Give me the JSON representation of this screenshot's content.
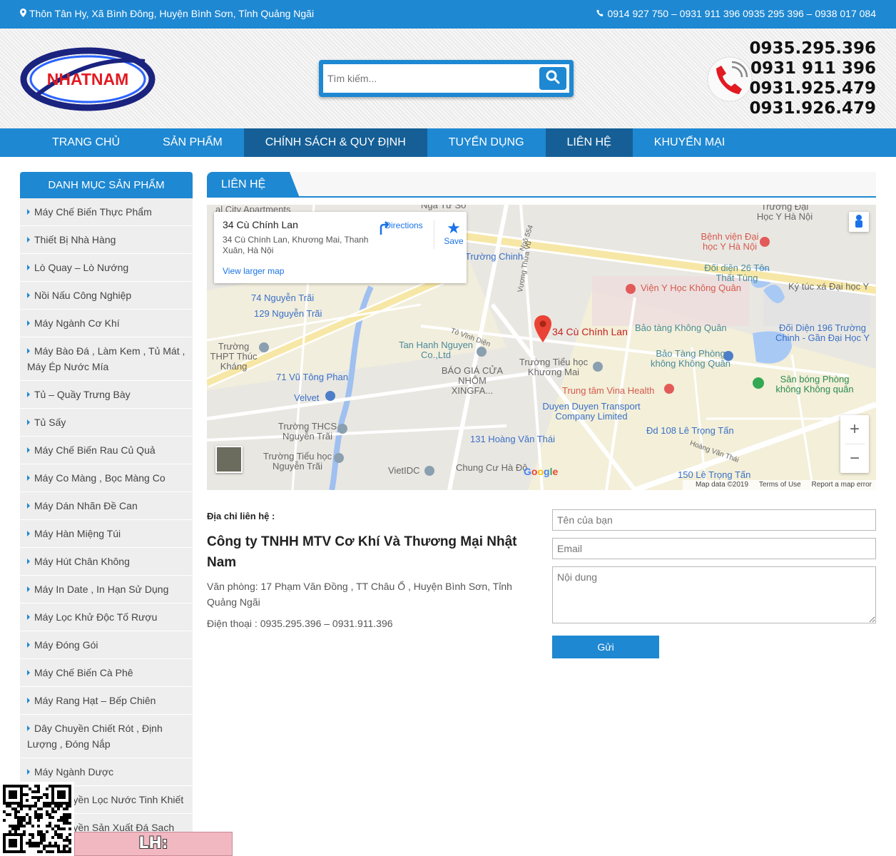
{
  "topbar": {
    "address": "Thôn Tân Hy, Xã Bình Đông, Huyện Bình Sơn, Tỉnh Quảng Ngãi",
    "phones": "0914 927 750 – 0931 911 396 0935 295 396 – 0938 017 084"
  },
  "header": {
    "logo_text": "NHATNAM",
    "search_placeholder": "Tìm kiếm...",
    "hotlines": [
      "0935.295.396",
      "0931 911 396",
      "0931.925.479",
      "0931.926.479"
    ]
  },
  "nav": {
    "items": [
      {
        "label": "TRANG CHỦ"
      },
      {
        "label": "SẢN PHẨM"
      },
      {
        "label": "CHÍNH SÁCH & QUY ĐỊNH"
      },
      {
        "label": "TUYỂN DỤNG"
      },
      {
        "label": "LIÊN HỆ"
      },
      {
        "label": "KHUYẾN MẠI"
      }
    ]
  },
  "sidebar": {
    "title": "DANH MỤC SẢN PHẨM",
    "items": [
      "Máy Chế Biến Thực Phẩm",
      "Thiết Bị Nhà Hàng",
      "Lò Quay – Lò Nướng",
      "Nồi Nấu Công Nghiệp",
      "Máy Ngành Cơ Khí",
      "Máy Bào Đá , Làm Kem , Tủ Mát , Máy Ép Nước Mía",
      "Tủ – Quầy Trưng Bày",
      "Tủ Sấy",
      "Máy Chế Biến Rau Củ Quả",
      "Máy Co Màng , Bọc Màng Co",
      "Máy Dán Nhãn Đề Can",
      "Máy Hàn Miệng Túi",
      "Máy Hút Chân Không",
      "Máy In Date , In Hạn Sử Dụng",
      "Máy Lọc Khử Độc Tố Rượu",
      "Máy Đóng Gói",
      "Máy Chế Biến Cà Phê",
      "Máy Rang Hạt – Bếp Chiên",
      "Dây Chuyền Chiết Rót , Định Lượng , Đóng Nắp",
      "Máy Ngành Dược",
      "Dây Chuyền Lọc Nước Tinh Khiết",
      "Dây Chuyền Sản Xuất Đá Sạch"
    ]
  },
  "content": {
    "tab_title": "LIÊN HỆ",
    "map": {
      "place_title": "34 Cù Chính Lan",
      "place_address": "34 Cù Chính Lan, Khương Mai, Thanh Xuân, Hà Nội",
      "directions": "Directions",
      "save": "Save",
      "larger_map": "View larger map",
      "pin_label": "34 Cù Chính Lan",
      "zoom_in": "+",
      "zoom_out": "−",
      "attribution": [
        "Map data ©2019",
        "Terms of Use",
        "Report a map error"
      ],
      "places": [
        {
          "name": "Nga Tư So",
          "kind": "gray"
        },
        {
          "name": "al City Apartments",
          "kind": "gray"
        },
        {
          "name": "Ngõ 554",
          "kind": "gray"
        },
        {
          "name": "Trường Đại Học Y Hà Nội",
          "kind": "gray"
        },
        {
          "name": "Bệnh viện Đại học Y Hà Nội",
          "kind": "red"
        },
        {
          "name": "Đối diện 26 Tôn Thất Tùng",
          "kind": "teal"
        },
        {
          "name": "Viện Y Học Không Quân",
          "kind": "red"
        },
        {
          "name": "Ký túc xá Đại học Y",
          "kind": "gray"
        },
        {
          "name": "Trường Chinh",
          "kind": "blue"
        },
        {
          "name": "74 Nguyễn Trãi",
          "kind": "blue"
        },
        {
          "name": "129 Nguyễn Trãi",
          "kind": "blue"
        },
        {
          "name": "Bảo tàng Không Quân",
          "kind": "teal"
        },
        {
          "name": "Đối Diện 196 Trường Chinh - Gần Đại Học Y",
          "kind": "blue"
        },
        {
          "name": "Tan Hanh Nguyen Co.,Ltd",
          "kind": "teal"
        },
        {
          "name": "Trường THPT Thúc Kháng",
          "kind": "gray"
        },
        {
          "name": "BÁO GIÁ CỬA NHÔM XINGFA...",
          "kind": "gray"
        },
        {
          "name": "Trường Tiểu học Khương Mai",
          "kind": "gray"
        },
        {
          "name": "Bảo Tàng Phòng không Không Quân",
          "kind": "teal"
        },
        {
          "name": "71 Vũ Tông Phan",
          "kind": "blue"
        },
        {
          "name": "Sân bóng Phòng không Không quân",
          "kind": "green"
        },
        {
          "name": "Trung tâm Vina Health",
          "kind": "red"
        },
        {
          "name": "Velvet",
          "kind": "blue"
        },
        {
          "name": "Duyen Duyen Transport Company Limited",
          "kind": "blue"
        },
        {
          "name": "Trường THCS Nguyễn Trãi",
          "kind": "gray"
        },
        {
          "name": "Đd 108 Lê Trọng Tấn",
          "kind": "blue"
        },
        {
          "name": "131 Hoàng Văn Thái",
          "kind": "blue"
        },
        {
          "name": "Trường Tiểu học Nguyễn Trãi",
          "kind": "gray"
        },
        {
          "name": "VietIDC",
          "kind": "gray"
        },
        {
          "name": "Chung Cư Hà Đô",
          "kind": "gray"
        },
        {
          "name": "150 Lê Trọng Tấn",
          "kind": "blue"
        },
        {
          "name": "Hoàng Văn Thái",
          "kind": "gray"
        },
        {
          "name": "Vương Thừa Vũ",
          "kind": "gray"
        },
        {
          "name": "Tô Vĩnh Diện",
          "kind": "gray"
        }
      ]
    },
    "info": {
      "label": "Địa chỉ liên hệ :",
      "company": "Công ty TNHH MTV Cơ Khí Và Thương Mại Nhật Nam",
      "office": "Văn phòng: 17 Phạm Văn Đồng , TT Châu Ổ , Huyện Bình Sơn, Tỉnh Quảng Ngãi",
      "phone": "Điện thoại : 0935.295.396 – 0931.911.396"
    },
    "form": {
      "name_placeholder": "Tên của bạn",
      "email_placeholder": "Email",
      "message_placeholder": "Nội dung",
      "send_label": "Gửi"
    }
  },
  "overlay": {
    "badge_text": "LH: hoangweb.net"
  },
  "colors": {
    "primary": "#1e88d2",
    "nav_active": "#155f96",
    "logo_red": "#e21b23",
    "logo_blue": "#1a237e"
  }
}
